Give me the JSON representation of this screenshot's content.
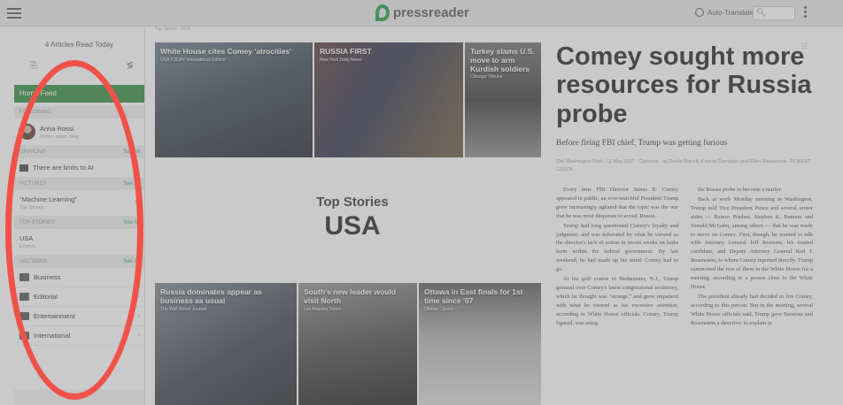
{
  "app": {
    "brand": "pressreader",
    "translate_label": "Auto-Translate",
    "search_placeholder": "",
    "accent": "#2e8b3b"
  },
  "sidebar": {
    "articles_read": "4 Articles Read Today",
    "home_feed": "Home Feed",
    "sections": {
      "following": {
        "head": "Following",
        "see_all": ""
      },
      "opinions": {
        "head": "Opinions",
        "see_all": "See All"
      },
      "pictures": {
        "head": "Pictures",
        "see_all": "See All"
      },
      "top_stories": {
        "head": "Top Stories",
        "see_all": "See All"
      },
      "sections": {
        "head": "Sections",
        "see_all": "See All"
      }
    },
    "following": {
      "name": "Anna Rossi",
      "sub": "Writer, editor, blog"
    },
    "opinion_item": "There are limits to AI",
    "picture_item": {
      "title": "\"Machine Learning\"",
      "sub": "Top Stories",
      "count": "10"
    },
    "topstory_item": {
      "title": "USA",
      "sub": "English"
    },
    "section_items": [
      "Business",
      "Editorial",
      "Entertainment",
      "International"
    ]
  },
  "main": {
    "crumb": "Top Stories · USA",
    "tiles": [
      {
        "title": "White House cites Comey 'atrocities'",
        "sub": "USA TODAY International Edition"
      },
      {
        "title": "RUSSIA FIRST",
        "sub": "New York Daily News"
      },
      {
        "title": "Turkey slams U.S. move to arm Kurdish soldiers",
        "sub": "Chicago Tribune"
      },
      {
        "title": "Russia dominates appear as business as usual",
        "sub": "The Wall Street Journal"
      },
      {
        "title": "South's new leader would visit North",
        "sub": "Los Angeles Times"
      },
      {
        "title": "Ottawa in East finals for 1st time since '07",
        "sub": "Ottawa Citizen"
      }
    ],
    "top_stories_label": "Top Stories",
    "top_stories_region": "USA",
    "article": {
      "headline": "Comey sought more resources for Russia probe",
      "subhead": "Before firing FBI chief, Trump was getting furious",
      "byline": "The Washington Post · 11 May 2017 · Opinions · by Devlin Barrett, Karoun Demirjian and Ellen Nakashima · ROBERT COSTA",
      "col1": [
        "Every time FBI Director James B. Comey appeared in public, an ever-watchful President Trump grew increasingly agitated that the topic was the one that he was most desperate to avoid: Russia.",
        "Trump had long questioned Comey's loyalty and judgment, and was infuriated by what he viewed as the director's lack of action in recent weeks on leaks from within the federal government. By last weekend, he had made up his mind: Comey had to go.",
        "At his golf course in Bedminster, N.J., Trump groused over Comey's latest congressional testimony, which he thought was \"strange,\" and grew impatient with what he viewed as his excessive attention, according to White House officials. Comey, Trump figured, was using"
      ],
      "col2": [
        "the Russia probe to become a martyr.",
        "Back at work Monday morning in Washington, Trump told Vice President Pence and several senior aides — Reince Priebus, Stephen K. Bannon and Donald McGahn, among others — that he was ready to move on Comey. First, though, he wanted to talk with Attorney General Jeff Sessions, his trusted confidant, and Deputy Attorney General Rod J. Rosenstein, to whom Comey reported directly. Trump summoned the two of them to the White House for a meeting, according to a person close to the White House.",
        "The president already had decided to fire Comey, according to this person. But in the meeting, several White House officials said, Trump gave Sessions and Rosenstein a directive: to explain in"
      ]
    }
  },
  "colors": {
    "annotation": "#f0524a",
    "header_bg": "#e9e9e9"
  }
}
